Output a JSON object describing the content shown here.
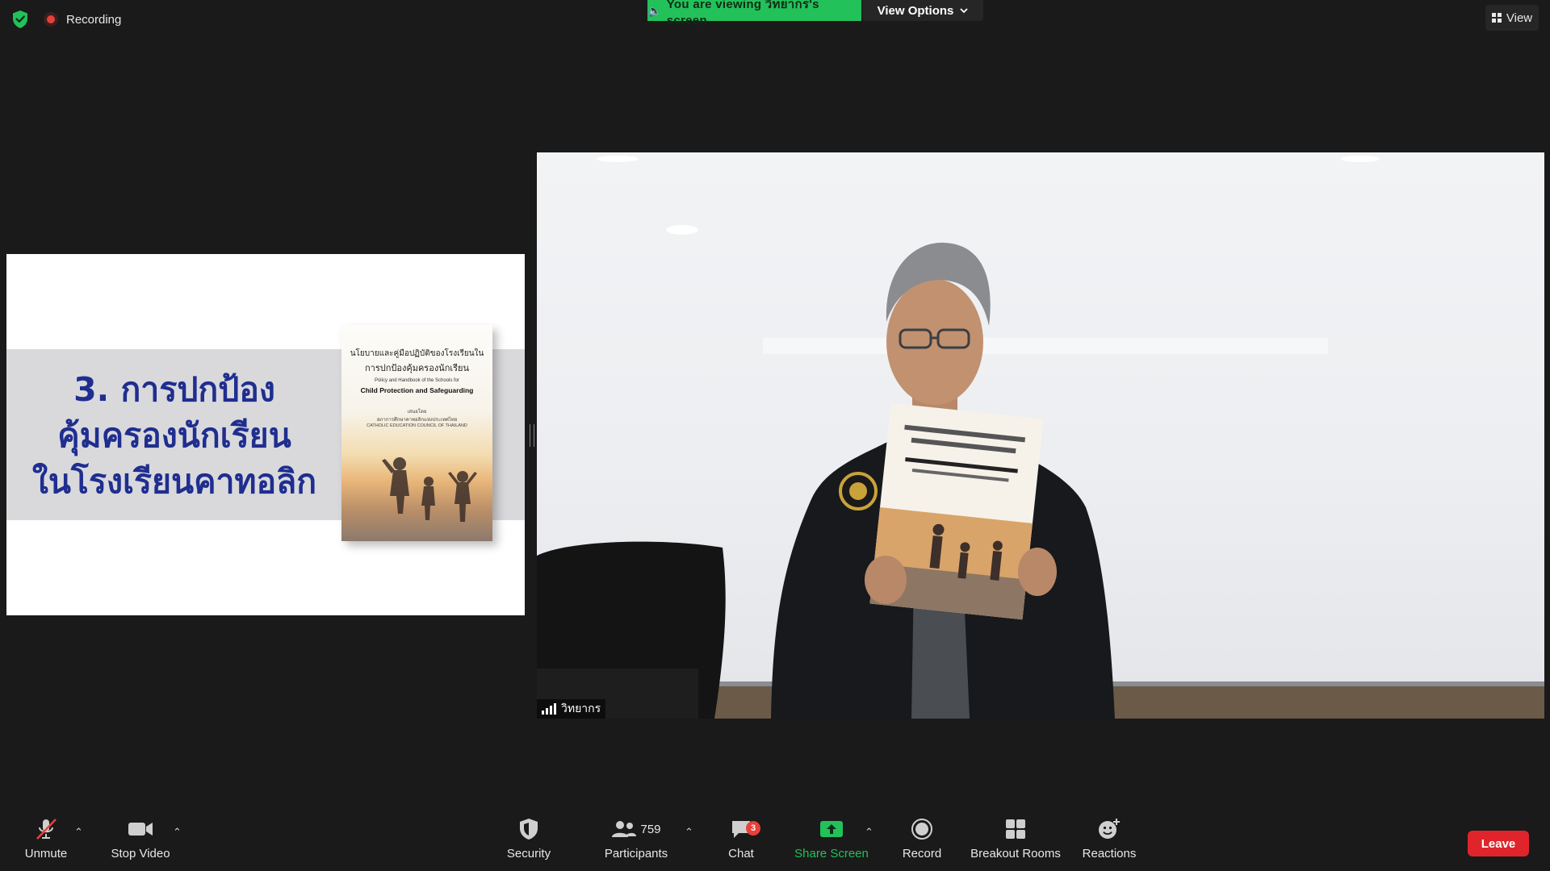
{
  "top_bar": {
    "recording_label": "Recording",
    "viewing_banner": "You are viewing วิทยากร's screen",
    "view_options_label": "View Options",
    "view_label": "View"
  },
  "shared_screen": {
    "slide_title_lines": [
      "3. การปกป้อง",
      "คุ้มครองนักเรียน",
      "ในโรงเรียนคาทอลิก"
    ],
    "book": {
      "thai_title_1": "นโยบายและคู่มือปฏิบัติของโรงเรียนใน",
      "thai_title_2": "การปกป้องคุ้มครองนักเรียน",
      "english_subtitle": "Policy and Handbook of the Schools for",
      "english_title": "Child Protection and Safeguarding",
      "publisher_label": "เสนอโดย",
      "publisher_thai": "สภาการศึกษาคาทอลิกแห่งประเทศไทย",
      "publisher_english": "CATHOLIC EDUCATION COUNCIL OF THAILAND"
    }
  },
  "video": {
    "participant_name": "วิทยากร"
  },
  "toolbar": {
    "unmute_label": "Unmute",
    "stop_video_label": "Stop Video",
    "security_label": "Security",
    "participants_label": "Participants",
    "participants_count": "759",
    "chat_label": "Chat",
    "chat_badge": "3",
    "share_screen_label": "Share Screen",
    "record_label": "Record",
    "breakout_rooms_label": "Breakout Rooms",
    "reactions_label": "Reactions",
    "leave_label": "Leave"
  },
  "colors": {
    "background": "#1a1a1a",
    "accent_green": "#22c15a",
    "leave_red": "#e0242b",
    "badge_red": "#e8403a",
    "slide_title_blue": "#1f2e8f"
  }
}
